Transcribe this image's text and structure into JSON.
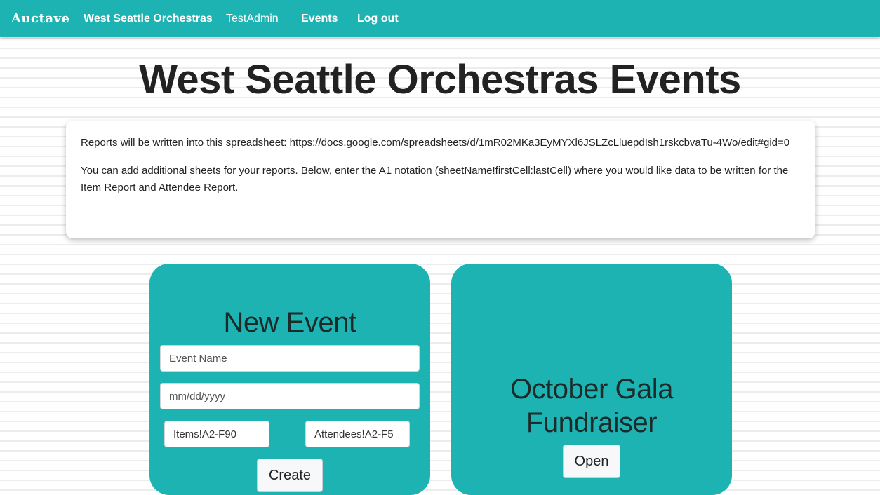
{
  "nav": {
    "brand": "Auctave",
    "links": [
      "West Seattle Orchestras",
      "TestAdmin",
      "Events",
      "Log out"
    ]
  },
  "page": {
    "title": "West Seattle Orchestras Events"
  },
  "info": {
    "line1": "Reports will be written into this spreadsheet: https://docs.google.com/spreadsheets/d/1mR02MKa3EyMYXl6JSLZcLluepdIsh1rskcbvaTu-4Wo/edit#gid=0",
    "line2": "You can add additional sheets for your reports. Below, enter the A1 notation (sheetName!firstCell:lastCell) where you would like data to be written for the Item Report and Attendee Report."
  },
  "new_event": {
    "title": "New Event",
    "name_placeholder": "Event Name",
    "date_placeholder": "mm/dd/yyyy",
    "items_value": "Items!A2-F90",
    "attendees_value": "Attendees!A2-F5",
    "create_label": "Create"
  },
  "events": [
    {
      "title": "October Gala Fundraiser",
      "open_label": "Open"
    }
  ],
  "colors": {
    "accent": "#1eb3b3",
    "text": "#222222"
  }
}
